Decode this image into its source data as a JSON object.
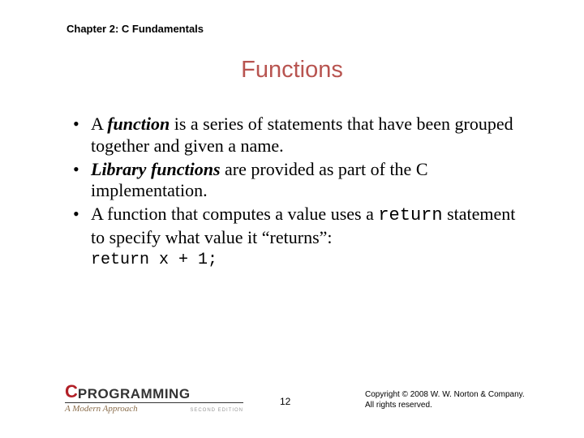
{
  "chapter": "Chapter 2: C Fundamentals",
  "title": "Functions",
  "bullets": {
    "b1": {
      "pre": "A ",
      "term": "function",
      "post": " is a series of statements that have been grouped together and given a name."
    },
    "b2": {
      "term": "Library functions",
      "post": " are provided as part of the C implementation."
    },
    "b3": {
      "pre": "A function that computes a value uses a ",
      "code1": "return",
      "mid": " statement to specify what value it “returns”:"
    }
  },
  "code_line": "return x + 1;",
  "footer": {
    "logo_c": "C",
    "logo_prog": "PROGRAMMING",
    "logo_sub": "A Modern Approach",
    "logo_ed": "SECOND EDITION",
    "page": "12",
    "copy1": "Copyright © 2008 W. W. Norton & Company.",
    "copy2": "All rights reserved."
  }
}
